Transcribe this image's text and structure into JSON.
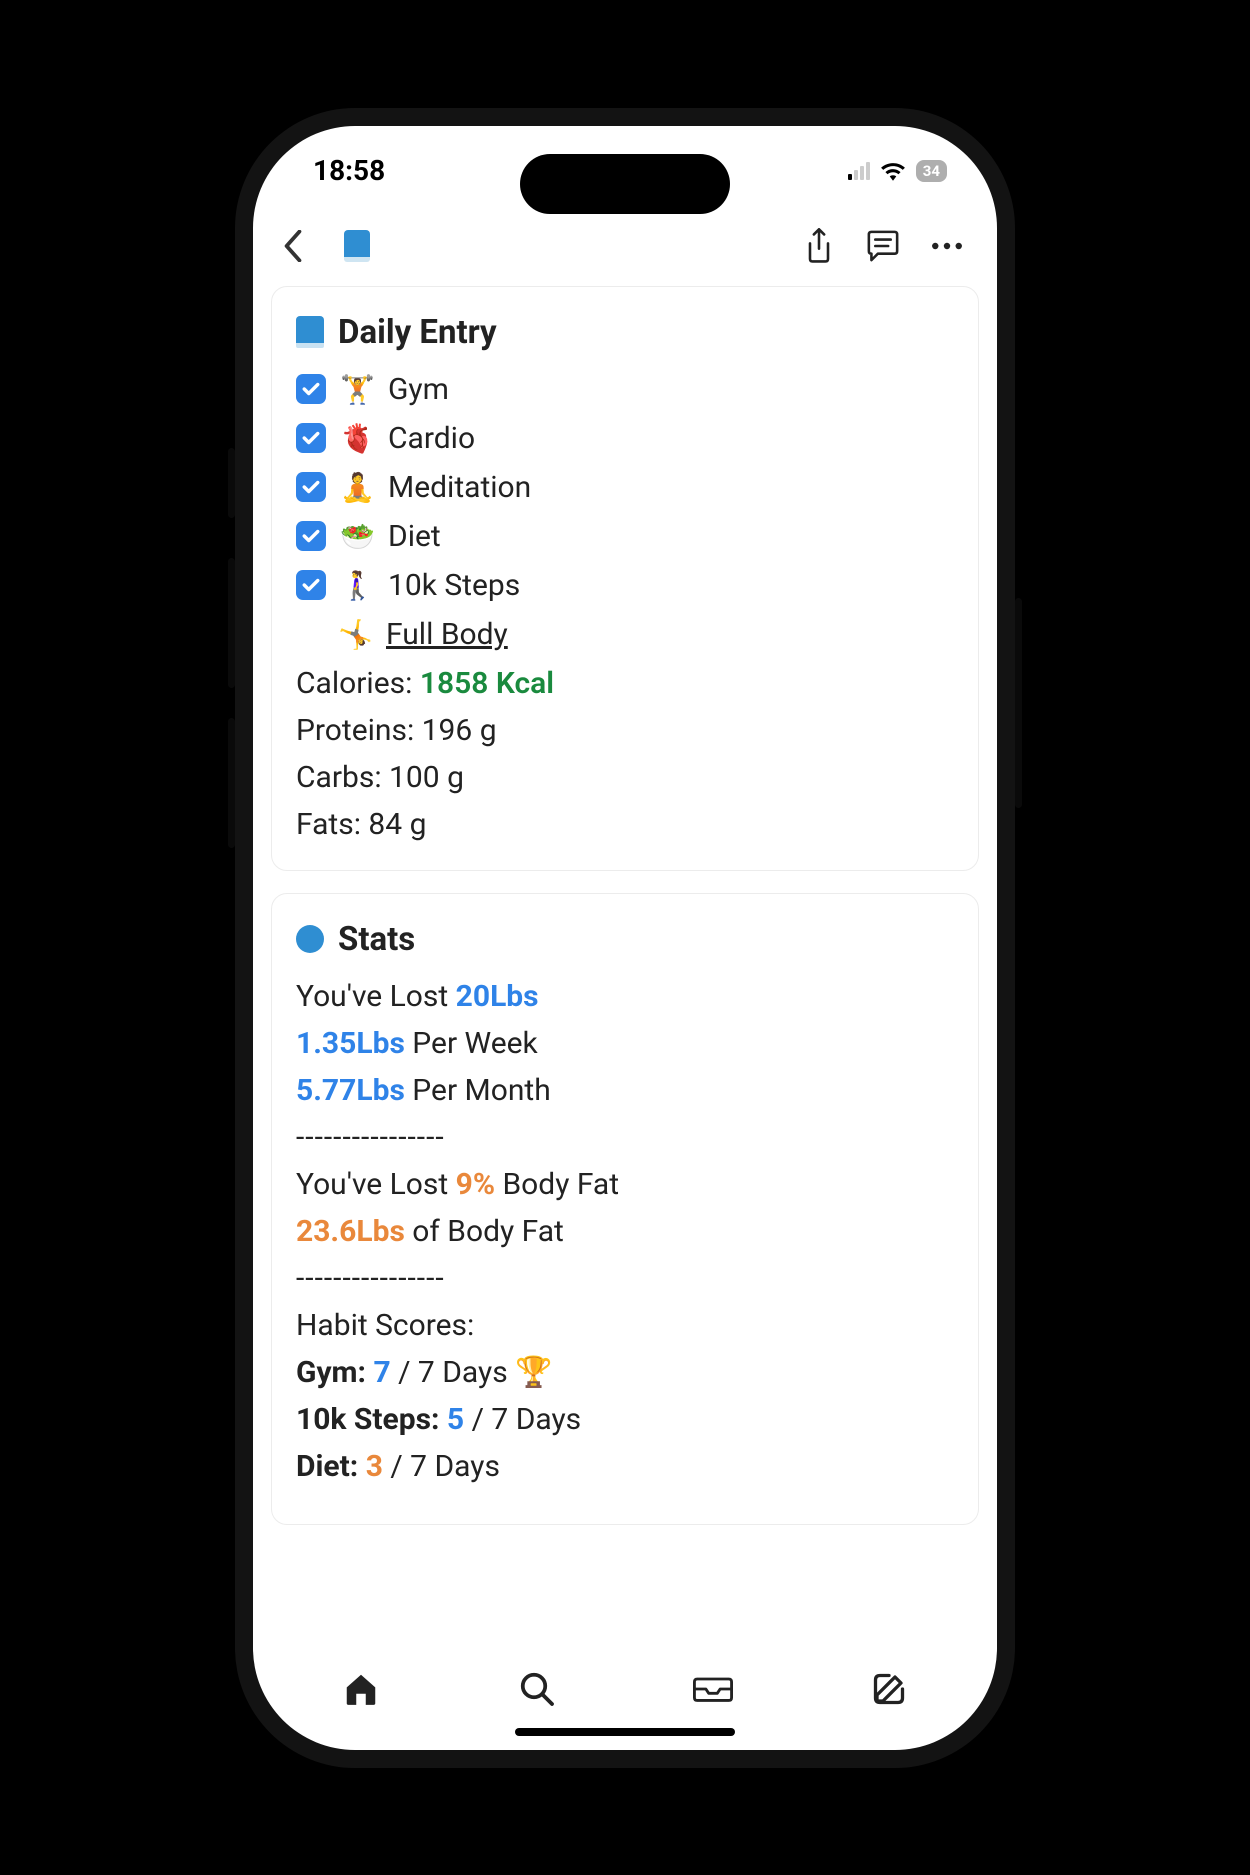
{
  "status": {
    "time": "18:58",
    "battery": "34"
  },
  "daily_entry": {
    "title": "Daily Entry",
    "checks": [
      {
        "emoji": "🏋️",
        "label": "Gym"
      },
      {
        "emoji": "🫀",
        "label": "Cardio"
      },
      {
        "emoji": "🧘",
        "label": "Meditation"
      },
      {
        "emoji": "🥗",
        "label": "Diet"
      },
      {
        "emoji": "🚶‍♀️",
        "label": "10k Steps"
      }
    ],
    "link": {
      "emoji": "🤸",
      "label": "Full Body"
    },
    "calories_label": "Calories: ",
    "calories_value": "1858 Kcal",
    "proteins": "Proteins: 196 g",
    "carbs": "Carbs: 100 g",
    "fats": "Fats: 84 g"
  },
  "stats": {
    "title": "Stats",
    "lost_prefix": "You've Lost ",
    "lost_amount": "20Lbs",
    "per_week_val": "1.35Lbs",
    "per_week_suffix": " Per Week",
    "per_month_val": "5.77Lbs",
    "per_month_suffix": " Per Month",
    "divider": "----------------",
    "bf_prefix": "You've Lost ",
    "bf_pct": "9%",
    "bf_suffix": " Body Fat",
    "bf_lbs": "23.6Lbs",
    "bf_lbs_suffix": " of Body Fat",
    "habit_header": "Habit Scores:",
    "habits": [
      {
        "name": "Gym:",
        "score": "7",
        "total": " / 7 Days ",
        "trophy": "🏆",
        "color": "blue"
      },
      {
        "name": "10k Steps:",
        "score": "5",
        "total": " / 7 Days",
        "trophy": "",
        "color": "blue"
      },
      {
        "name": "Diet:",
        "score": "3",
        "total": " / 7 Days",
        "trophy": "",
        "color": "orange"
      }
    ]
  }
}
